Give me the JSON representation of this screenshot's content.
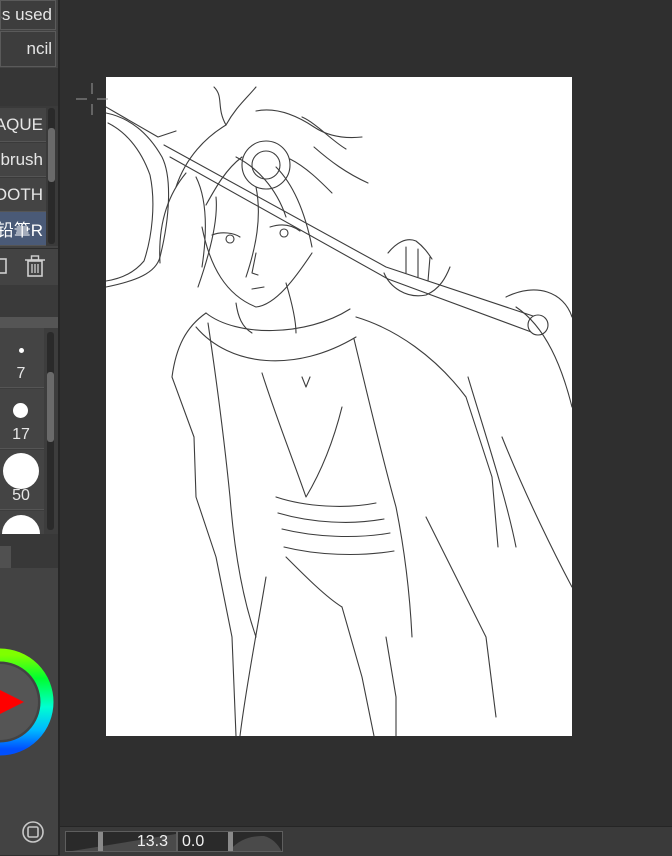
{
  "sub_tools": {
    "top_label": "ss used",
    "second_label": "ncil"
  },
  "tool_list": {
    "items": [
      {
        "label": "AQUE"
      },
      {
        "label": "brush"
      },
      {
        "label": "OOTH"
      },
      {
        "label": "铅筆R"
      }
    ],
    "selected_index": 3
  },
  "tool_icons": {
    "copy_icon": "copy-icon",
    "delete_icon": "trash-icon"
  },
  "brush_sizes": {
    "items": [
      {
        "label": "7"
      },
      {
        "label": "17"
      },
      {
        "label": "50"
      },
      {
        "label": ""
      }
    ]
  },
  "status_bar": {
    "zoom_value": "13.3",
    "rotation_value": "0.0"
  },
  "colors": {
    "main_color": "#ff0000"
  }
}
